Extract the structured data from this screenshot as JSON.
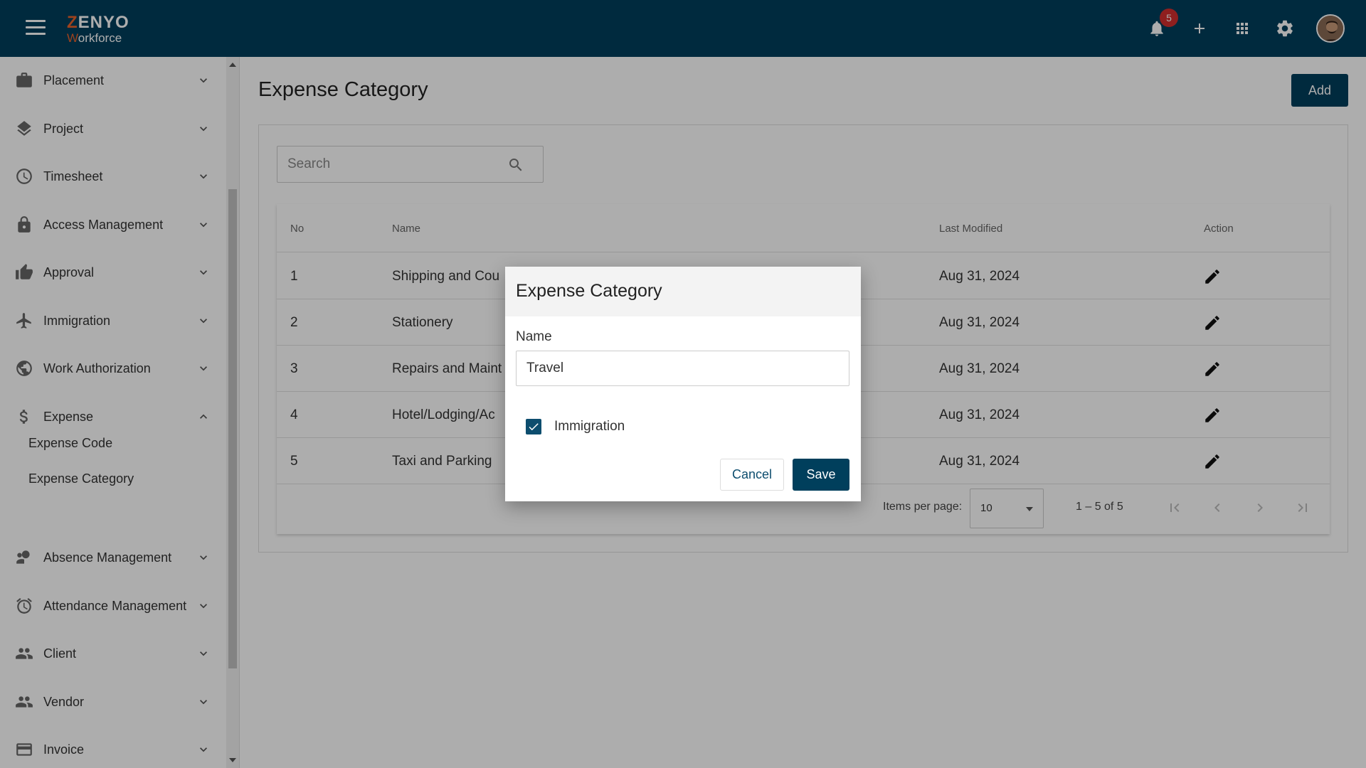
{
  "header": {
    "logo_top": "ZENYO",
    "logo_bottom": "Workforce",
    "notification_count": "5",
    "icons": [
      "menu-icon",
      "bell-icon",
      "plus-icon",
      "apps-grid-icon",
      "gear-icon",
      "user-avatar"
    ]
  },
  "sidebar": {
    "items": [
      {
        "label": "Placement",
        "icon": "briefcase-icon",
        "expanded": false
      },
      {
        "label": "Project",
        "icon": "layers-icon",
        "expanded": false
      },
      {
        "label": "Timesheet",
        "icon": "clock-icon",
        "expanded": false
      },
      {
        "label": "Access Management",
        "icon": "lock-icon",
        "expanded": false
      },
      {
        "label": "Approval",
        "icon": "thumb-up-icon",
        "expanded": false
      },
      {
        "label": "Immigration",
        "icon": "airplane-icon",
        "expanded": false
      },
      {
        "label": "Work Authorization",
        "icon": "globe-icon",
        "expanded": false
      },
      {
        "label": "Expense",
        "icon": "dollar-icon",
        "expanded": true
      },
      {
        "label": "Absence Management",
        "icon": "person-clock-icon",
        "expanded": false
      },
      {
        "label": "Attendance Management",
        "icon": "alarm-icon",
        "expanded": false
      },
      {
        "label": "Client",
        "icon": "people-icon",
        "expanded": false
      },
      {
        "label": "Vendor",
        "icon": "people-icon",
        "expanded": false
      },
      {
        "label": "Invoice",
        "icon": "credit-card-icon",
        "expanded": false
      }
    ],
    "sub_items": [
      "Expense Code",
      "Expense Category"
    ]
  },
  "main": {
    "title": "Expense Category",
    "add_label": "Add",
    "search_placeholder": "Search",
    "columns": [
      "No",
      "Name",
      "Last Modified",
      "Action"
    ],
    "rows": [
      {
        "no": "1",
        "name": "Shipping and Cou",
        "modified": "Aug 31, 2024"
      },
      {
        "no": "2",
        "name": "Stationery",
        "modified": "Aug 31, 2024"
      },
      {
        "no": "3",
        "name": "Repairs and Maint",
        "modified": "Aug 31, 2024"
      },
      {
        "no": "4",
        "name": "Hotel/Lodging/Ac",
        "modified": "Aug 31, 2024"
      },
      {
        "no": "5",
        "name": "Taxi and Parking",
        "modified": "Aug 31, 2024"
      }
    ],
    "paginator": {
      "items_per_page_label": "Items per page:",
      "items_per_page_value": "10",
      "range": "1 – 5 of 5"
    }
  },
  "dialog": {
    "title": "Expense Category",
    "name_label": "Name",
    "name_value": "Travel",
    "checkbox_label": "Immigration",
    "checkbox_checked": true,
    "cancel_label": "Cancel",
    "save_label": "Save"
  },
  "colors": {
    "primary": "#003f5c",
    "accent": "#e8622c",
    "badge": "#d32f2f"
  }
}
